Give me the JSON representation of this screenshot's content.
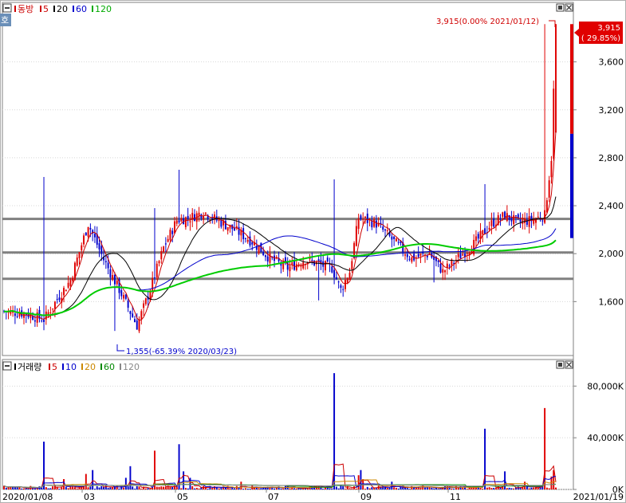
{
  "header": {
    "ho_label": "호",
    "price_legend": [
      {
        "text": "동방",
        "color": "#cc0000"
      },
      {
        "text": "5",
        "color": "#cc0000"
      },
      {
        "text": "20",
        "color": "#000000"
      },
      {
        "text": "60",
        "color": "#0000cc"
      },
      {
        "text": "120",
        "color": "#00aa00"
      }
    ],
    "volume_legend": [
      {
        "text": "거래량",
        "color": "#000000"
      },
      {
        "text": "5",
        "color": "#cc0000"
      },
      {
        "text": "10",
        "color": "#0000cc"
      },
      {
        "text": "20",
        "color": "#cc8800"
      },
      {
        "text": "60",
        "color": "#008800"
      },
      {
        "text": "120",
        "color": "#888888"
      }
    ]
  },
  "colors": {
    "up": "#e00000",
    "down": "#0000cc",
    "ma5": "#cc0000",
    "ma20": "#000000",
    "ma60": "#0000cc",
    "ma120": "#00cc00",
    "vol_ma20": "#cc8800",
    "vol_ma60": "#008800",
    "vol_ma120": "#888888",
    "support_lines": "#808080"
  },
  "chart_data": [
    {
      "type": "candlestick",
      "title": "동방",
      "y_ticks": [
        1600,
        2000,
        2400,
        2800,
        3200,
        3600
      ],
      "y_tick_labels": [
        "1,600",
        "2,000",
        "2,400",
        "2,800",
        "3,200",
        "3,600"
      ],
      "ylim": [
        1150,
        3950
      ],
      "moving_averages": [
        "5",
        "20",
        "60",
        "120"
      ],
      "horizontal_lines": [
        2290,
        2010,
        1790
      ],
      "annotations": {
        "high": "3,915(0.00% 2021/01/12)",
        "low": "1,355(-65.39% 2020/03/23)",
        "last_price": "3,915",
        "last_change": "( 29.85%)"
      },
      "key_points": [
        {
          "date": "2020/01/08",
          "close": 1520
        },
        {
          "date": "2020/02/05",
          "high": 2640
        },
        {
          "date": "2020/03/23",
          "low": 1355
        },
        {
          "date": "2020/04/20",
          "high": 2380
        },
        {
          "date": "2020/05/07",
          "high": 2700
        },
        {
          "date": "2020/08/10",
          "low": 1610
        },
        {
          "date": "2020/08/20",
          "high": 2620
        },
        {
          "date": "2020/10/27",
          "low": 1760
        },
        {
          "date": "2020/12/01",
          "high": 2580
        },
        {
          "date": "2021/01/12",
          "high": 3915
        },
        {
          "date": "2021/01/19",
          "close": 3915
        }
      ]
    },
    {
      "type": "bar",
      "title": "거래량",
      "y_ticks": [
        0,
        40000,
        80000
      ],
      "y_tick_labels": [
        "0K",
        "40,000K",
        "80,000K"
      ],
      "ylim": [
        0,
        95000
      ],
      "moving_averages": [
        "5",
        "10",
        "20",
        "60",
        "120"
      ],
      "key_points": [
        {
          "date": "2020/02/05",
          "volume": 37000
        },
        {
          "date": "2020/04/20",
          "volume": 30000
        },
        {
          "date": "2020/05/07",
          "volume": 35000
        },
        {
          "date": "2020/08/20",
          "volume": 90000
        },
        {
          "date": "2020/12/01",
          "volume": 47000
        },
        {
          "date": "2021/01/12",
          "volume": 63000
        }
      ]
    }
  ],
  "x_axis": {
    "labels": [
      "2020/01/08",
      "03",
      "05",
      "07",
      "09",
      "11",
      "2021/01/19"
    ]
  }
}
